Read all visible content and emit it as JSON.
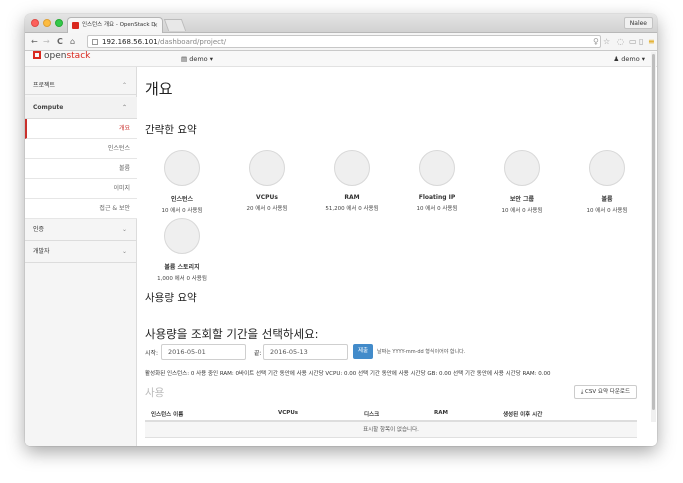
{
  "browser": {
    "tab_title": "인스턴스 개요 - OpenStack D",
    "tab_close": "×",
    "profile_name": "Nalee",
    "url_host": "192.168.56.101",
    "url_path": "/dashboard/project/",
    "nav_back": "←",
    "nav_forward": "→",
    "nav_reload": "C",
    "nav_home": "⌂"
  },
  "header": {
    "logo_open": "open",
    "logo_stack": "stack",
    "project_label": "demo ▾",
    "user_label": "demo ▾"
  },
  "sidebar": {
    "panel_project": "프로젝트",
    "section_compute": "Compute",
    "items": [
      {
        "label": "개요",
        "active": true
      },
      {
        "label": "인스턴스",
        "active": false
      },
      {
        "label": "볼륨",
        "active": false
      },
      {
        "label": "이미지",
        "active": false
      },
      {
        "label": "접근 & 보안",
        "active": false
      }
    ],
    "panel_identity": "인증",
    "panel_developer": "개발자"
  },
  "main": {
    "title": "개요",
    "limit_summary_title": "간략한 요약",
    "pies": [
      {
        "label": "인스턴스",
        "usage": "10 에서 0 사용됨"
      },
      {
        "label": "VCPUs",
        "usage": "20 에서 0 사용됨"
      },
      {
        "label": "RAM",
        "usage": "51,200 에서 0 사용됨"
      },
      {
        "label": "Floating IP",
        "usage": "10 에서 0 사용됨"
      },
      {
        "label": "보안 그룹",
        "usage": "10 에서 0 사용됨"
      },
      {
        "label": "볼륨",
        "usage": "10 에서 0 사용됨"
      },
      {
        "label": "볼륨 스토리지",
        "usage": "1,000 에서 0 사용됨"
      }
    ],
    "usage_summary_title": "사용량 요약",
    "period_title": "사용량을 조회할 기간을 선택하세요:",
    "start_label": "시작:",
    "start_value": "2016-05-01",
    "end_label": "끝:",
    "end_value": "2016-05-13",
    "submit_label": "제출",
    "date_hint": "날짜는 YYYY-mm-dd 형식이어야 합니다.",
    "usage_stats": "활성화된 인스턴스: 0 사용 중인 RAM: 0바이트 선택 기간 동안에 사용 시간당 VCPU: 0.00 선택 기간 동안에 사용 시간당 GB: 0.00 선택 기간 동안에 사용 시간당 RAM: 0.00",
    "usage_title": "사용",
    "csv_button": "CSV 요약 다운로드",
    "table": {
      "columns": [
        "인스턴스 이름",
        "VCPUs",
        "디스크",
        "RAM",
        "생성된 이후 시간"
      ],
      "empty_message": "표시할 항목이 없습니다."
    }
  },
  "colors": {
    "accent_red": "#d9281e",
    "active_red": "#c9302c",
    "button_blue": "#428bca"
  }
}
